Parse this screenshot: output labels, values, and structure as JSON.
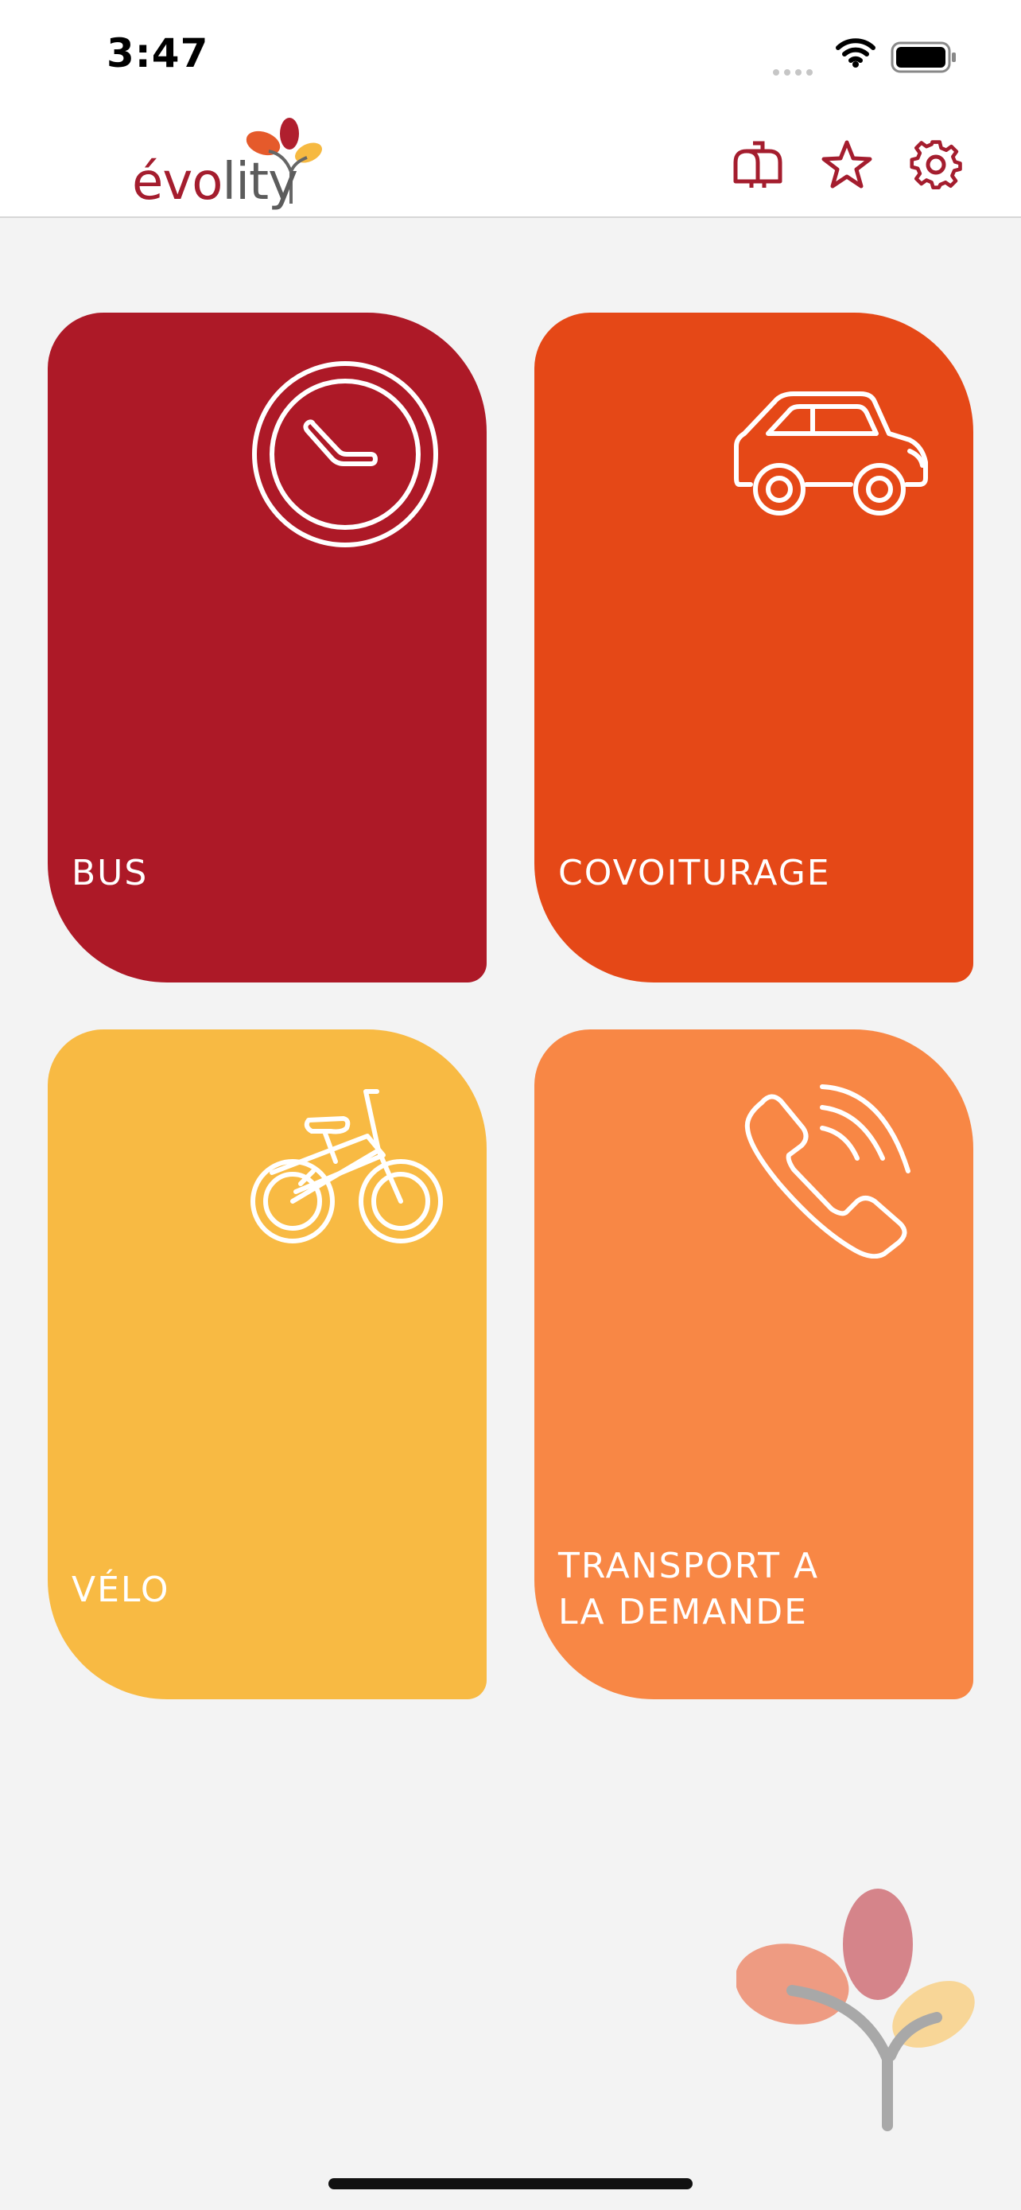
{
  "status_bar": {
    "time": "3:47"
  },
  "header": {
    "logo_text_1": "évo",
    "logo_text_2": "lity",
    "icons": [
      "mailbox-icon",
      "star-icon",
      "gear-icon"
    ]
  },
  "tiles": [
    {
      "label": "BUS",
      "icon": "clock-icon",
      "color": "#ad1927"
    },
    {
      "label": "COVOITURAGE",
      "icon": "car-icon",
      "color": "#e54817"
    },
    {
      "label": "VÉLO",
      "icon": "bike-icon",
      "color": "#f8ba43"
    },
    {
      "label_line1": "TRANSPORT A",
      "label_line2": "LA DEMANDE",
      "icon": "phone-icon",
      "color": "#f88745"
    }
  ],
  "colors": {
    "brand_red": "#a41d2e",
    "background": "#f3f3f3"
  }
}
